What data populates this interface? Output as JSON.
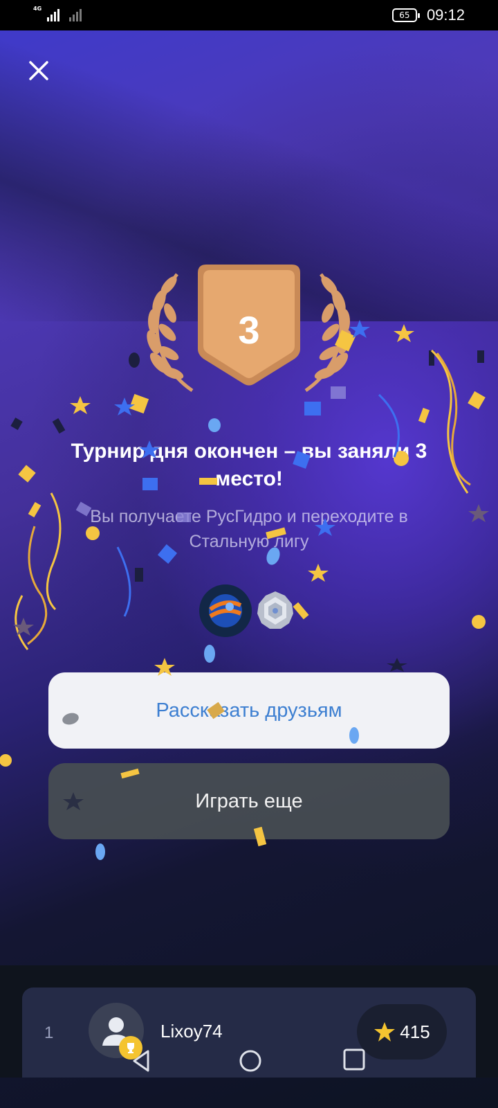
{
  "status_bar": {
    "network": "4G",
    "battery": "65",
    "time": "09:12"
  },
  "icons": {
    "close": "close-icon",
    "laurel": "laurel-wreath-icon",
    "star": "star-icon",
    "trophy": "trophy-icon",
    "league": "steel-league-badge-icon",
    "company_logo": "rushydro-logo-icon"
  },
  "result": {
    "place": "3",
    "title": "Турнир дня окончен – вы заняли 3 место!",
    "subtitle": "Вы получаете РусГидро и переходите в Стальную лигу"
  },
  "buttons": {
    "share": "Рассказать друзьям",
    "play_again": "Играть еще"
  },
  "leaderboard": {
    "rank": "1",
    "username": "Lixoy74",
    "score": "415"
  },
  "colors": {
    "medal": "#e3a066",
    "share_text": "#3d7fd1",
    "star": "#f4c430"
  }
}
